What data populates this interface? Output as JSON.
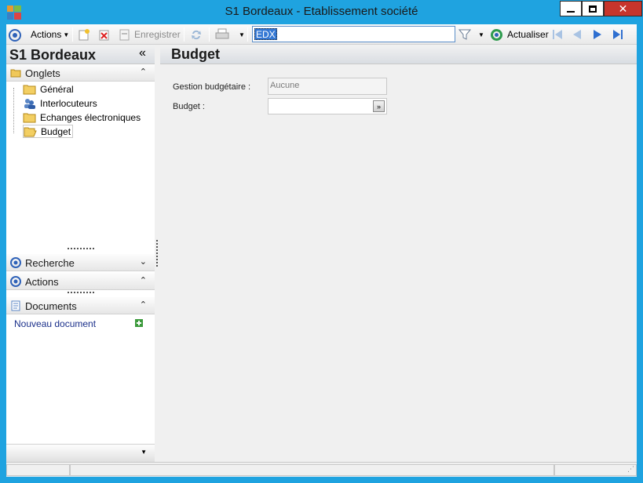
{
  "window": {
    "title": "S1 Bordeaux -  Etablissement société"
  },
  "toolbar": {
    "actions_label": "Actions",
    "save_label": "Enregistrer",
    "search_value": "EDX",
    "refresh_label": "Actualiser"
  },
  "left": {
    "title": "S1 Bordeaux",
    "tabs_section": "Onglets",
    "tabs": [
      {
        "label": "Général",
        "icon": "folder-icon"
      },
      {
        "label": "Interlocuteurs",
        "icon": "users-icon"
      },
      {
        "label": "Echanges électroniques",
        "icon": "folder-icon"
      },
      {
        "label": "Budget",
        "icon": "folder-open-icon",
        "selected": true
      }
    ],
    "search_section": "Recherche",
    "actions_section": "Actions",
    "documents_section": "Documents",
    "new_document": "Nouveau document"
  },
  "main": {
    "title": "Budget",
    "gestion_label": "Gestion budgétaire :",
    "gestion_value": "Aucune",
    "budget_label": "Budget :",
    "budget_value": ""
  },
  "colors": {
    "frame": "#1fa3e0",
    "close": "#c7352c",
    "accent": "#3478d4",
    "link": "#1a2f8a"
  }
}
